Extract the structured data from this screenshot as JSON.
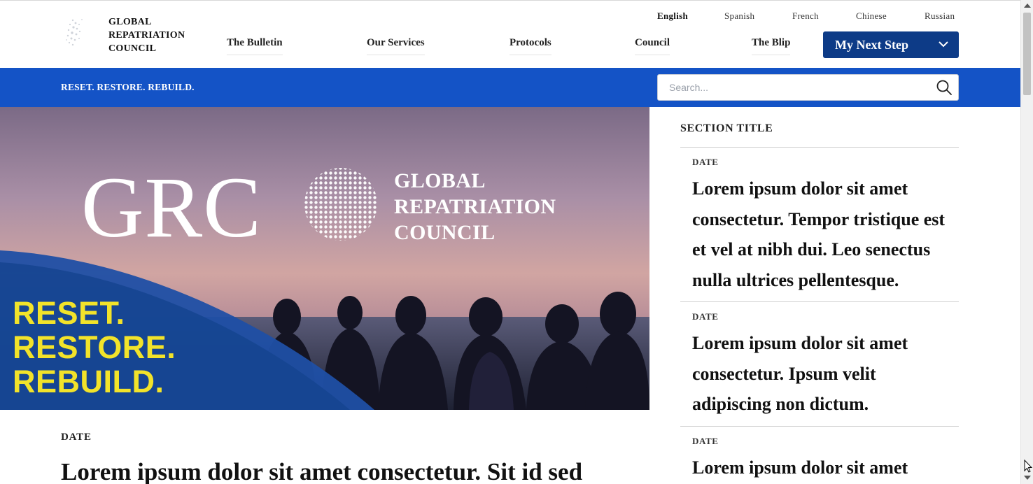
{
  "header": {
    "logo_lines": [
      "GLOBAL",
      "REPATRIATION",
      "COUNCIL"
    ],
    "languages": [
      {
        "label": "English",
        "active": true
      },
      {
        "label": "Spanish",
        "active": false
      },
      {
        "label": "French",
        "active": false
      },
      {
        "label": "Chinese",
        "active": false
      },
      {
        "label": "Russian",
        "active": false
      }
    ],
    "nav": [
      {
        "label": "The Bulletin"
      },
      {
        "label": "Our Services"
      },
      {
        "label": "Protocols"
      },
      {
        "label": "Council"
      },
      {
        "label": "The Blip"
      }
    ],
    "cta": {
      "label": "My Next Step",
      "icon": "chevron-down-icon"
    }
  },
  "band": {
    "tagline": "RESET. RESTORE. REBUILD.",
    "search": {
      "placeholder": "Search...",
      "value": "",
      "icon": "search-icon"
    }
  },
  "hero": {
    "acronym": "GRC",
    "name_lines": [
      "GLOBAL",
      "REPATRIATION",
      "COUNCIL"
    ],
    "slogan_lines": [
      "RESET.",
      "RESTORE.",
      "REBUILD."
    ]
  },
  "article": {
    "date": "DATE",
    "title": "Lorem ipsum dolor sit amet consectetur. Sit id sed"
  },
  "sidebar": {
    "section_title": "SECTION TITLE",
    "items": [
      {
        "date": "DATE",
        "title": "Lorem ipsum dolor sit amet consectetur. Tempor tristique est et vel at nibh dui. Leo senectus nulla ultrices pellentesque."
      },
      {
        "date": "DATE",
        "title": "Lorem ipsum dolor sit amet consectetur. Ipsum velit adipiscing non dictum."
      },
      {
        "date": "DATE",
        "title": "Lorem ipsum dolor sit amet"
      }
    ]
  },
  "colors": {
    "band_blue": "#1453c6",
    "cta_navy": "#0d3b87",
    "slogan_yellow": "#f2e32a"
  }
}
